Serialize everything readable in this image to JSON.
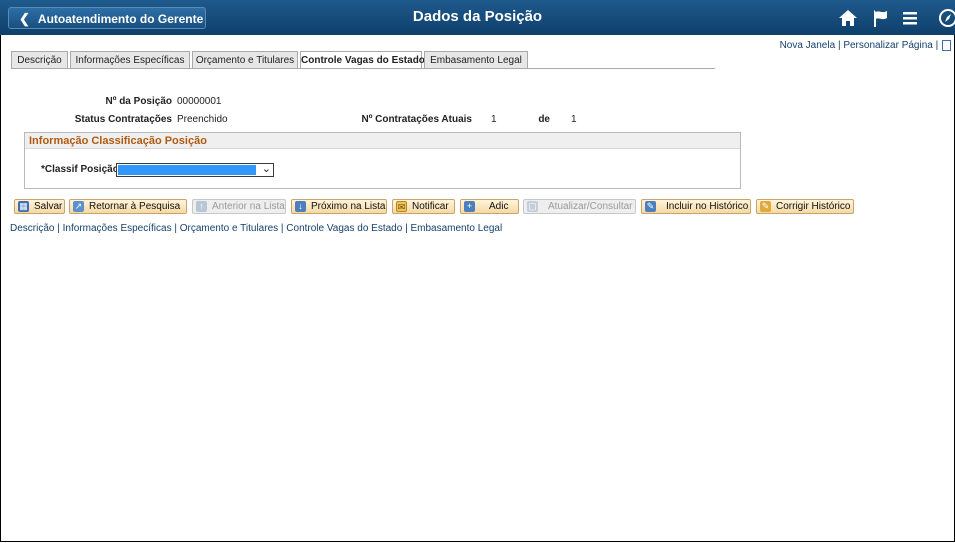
{
  "header": {
    "back_label": "Autoatendimento do Gerente",
    "title": "Dados da Posição",
    "icons": [
      "home-icon",
      "flag-icon",
      "menu-icon",
      "navbar-icon"
    ]
  },
  "top_links": {
    "new_window": "Nova Janela",
    "separator": "|",
    "personalize": "Personalizar Página",
    "separator2": "|"
  },
  "tabs": [
    {
      "label": "Descrição"
    },
    {
      "label": "Informações Específicas"
    },
    {
      "label": "Orçamento e Titulares"
    },
    {
      "label": "Controle Vagas do Estado",
      "active": true
    },
    {
      "label": "Embasamento Legal"
    }
  ],
  "fields": {
    "position_number_label": "Nº da Posição",
    "position_number_value": "00000001",
    "hiring_status_label": "Status Contratações",
    "hiring_status_value": "Preenchido",
    "current_hires_label": "Nº Contratações Atuais",
    "current_hires_value": "1",
    "of_label": "de",
    "of_value": "1"
  },
  "group": {
    "title": "Informação Classificação Posição",
    "select_label": "*Classif Posição:",
    "select_value": ""
  },
  "toolbar": {
    "save": "Salvar",
    "return_search": "Retornar à Pesquisa",
    "previous": "Anterior na Lista",
    "next": "Próximo na Lista",
    "notify": "Notificar",
    "add": "Adic",
    "update": "Atualizar/Consultar",
    "include_history": "Incluir no Histórico",
    "correct_history": "Corrigir Histórico"
  },
  "bottom_links": {
    "l1": "Descrição",
    "l2": "Informações Específicas",
    "l3": "Orçamento e Titulares",
    "l4": "Controle Vagas do Estado",
    "l5": "Embasamento Legal",
    "sep": "|"
  },
  "colors": {
    "header": "#0f3f6b",
    "link": "#16406b",
    "group_title": "#b05a11",
    "button": "#f5d9a3",
    "selection": "#3297fd"
  }
}
